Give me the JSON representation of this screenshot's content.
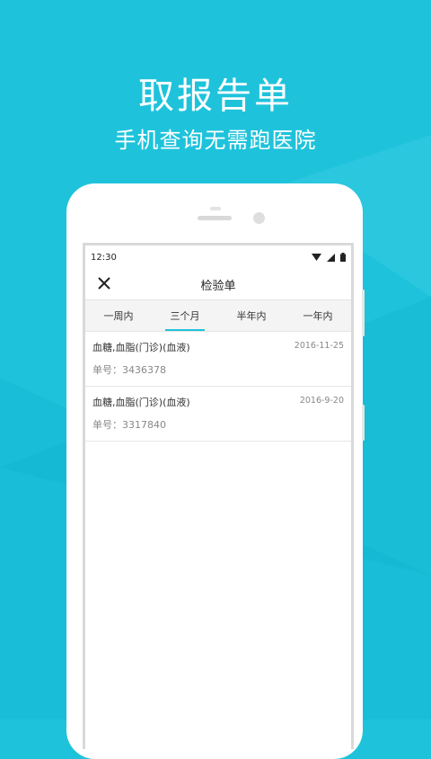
{
  "promo": {
    "title": "取报告单",
    "subtitle": "手机查询无需跑医院"
  },
  "status_bar": {
    "time": "12:30"
  },
  "app_bar": {
    "title": "检验单"
  },
  "tabs": [
    {
      "label": "一周内",
      "active": false
    },
    {
      "label": "三个月",
      "active": true
    },
    {
      "label": "半年内",
      "active": false
    },
    {
      "label": "一年内",
      "active": false
    }
  ],
  "records": [
    {
      "name": "血糖,血脂(门诊)(血液)",
      "number": "单号：3436378",
      "date": "2016-11-25"
    },
    {
      "name": "血糖,血脂(门诊)(血液)",
      "number": "单号：3317840",
      "date": "2016-9-20"
    }
  ],
  "colors": {
    "background": "#1ec3db",
    "accent": "#1ec3db"
  }
}
